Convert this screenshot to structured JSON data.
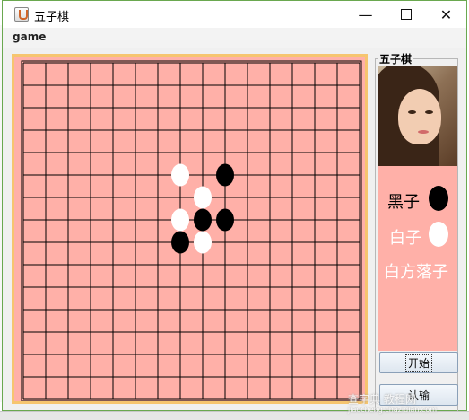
{
  "window": {
    "title": "五子棋"
  },
  "menu": {
    "game": "game"
  },
  "board": {
    "lines": 16,
    "stones": [
      {
        "color": "white",
        "col": 7,
        "row": 5
      },
      {
        "color": "black",
        "col": 9,
        "row": 5
      },
      {
        "color": "white",
        "col": 8,
        "row": 6
      },
      {
        "color": "white",
        "col": 7,
        "row": 7
      },
      {
        "color": "black",
        "col": 8,
        "row": 7
      },
      {
        "color": "black",
        "col": 9,
        "row": 7
      },
      {
        "color": "black",
        "col": 7,
        "row": 8
      },
      {
        "color": "white",
        "col": 8,
        "row": 8
      }
    ]
  },
  "side": {
    "title": "五子棋",
    "black_label": "黑子",
    "white_label": "白子",
    "turn": "白方落子",
    "start_button": "开始",
    "second_button": "认输"
  },
  "watermark": {
    "line1": "查字典 教程网",
    "line2": "jiaocheng.chazidian.com"
  },
  "colors": {
    "board": "#ffb0a8",
    "frame": "#f6c56f"
  }
}
